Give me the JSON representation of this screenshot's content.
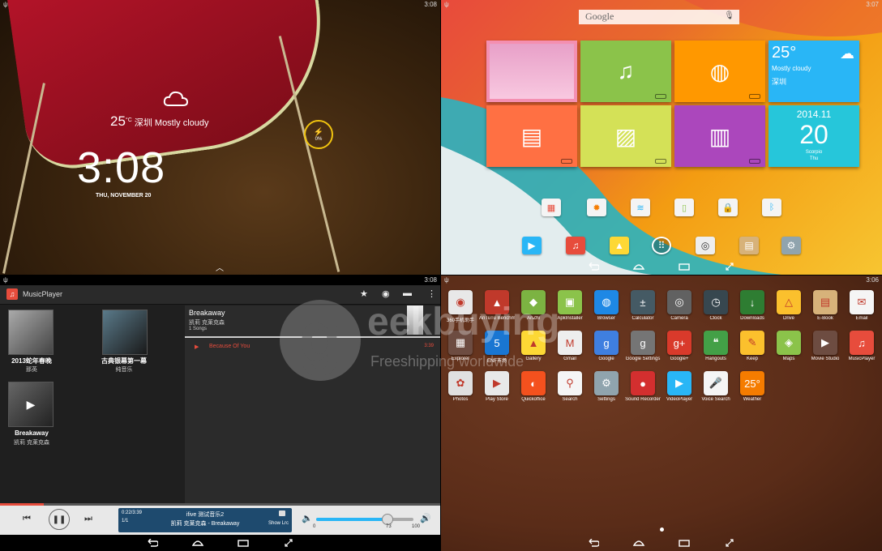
{
  "lockscreen": {
    "time_status": "3:08",
    "temperature": "25",
    "temp_unit": "°C",
    "weather_text": "深圳 Mostly cloudy",
    "clock": "3:08",
    "date": "THU, NOVEMBER 20",
    "battery": "0%"
  },
  "launcher": {
    "time_status": "3:07",
    "search_label": "Google",
    "weather_temp": "25°",
    "weather_desc": "Mostly cloudy",
    "weather_city": "深圳",
    "cal_month": "2014.11",
    "cal_day": "20",
    "cal_sub1": "Scorpio",
    "cal_sub2": "Thu"
  },
  "music": {
    "time_status": "3:08",
    "app_title": "MusicPlayer",
    "albums": [
      {
        "title": "2013蛇年春晚",
        "artist": "那英"
      },
      {
        "title": "古典银幕第一幕",
        "artist": "纯音乐"
      },
      {
        "title": "Breakaway",
        "artist": "凯莉 克莱克森"
      }
    ],
    "detail_title": "Breakaway",
    "detail_artist": "凯莉 克莱克森",
    "detail_count": "1 Songs",
    "track_name": "Because Of You",
    "track_time": "3:39",
    "now_time": "0:22/3:39",
    "now_index": "1/1",
    "now_title": "ifive 测试音乐2",
    "now_sub": "凯莉 克莱克森 - Breakaway",
    "show_lrc": "Show Lrc",
    "vol_min": "0",
    "vol_val": "73",
    "vol_max": "100",
    "progress": 0.1,
    "volume": 0.73
  },
  "drawer": {
    "time_status": "3:06",
    "apps": [
      {
        "label": "360手机助手",
        "color": "#e8e8e8",
        "glyph": "◉"
      },
      {
        "label": "AnTuTu Benchmark",
        "color": "#c0392b",
        "glyph": "▲"
      },
      {
        "label": "AnZhi",
        "color": "#7cb342",
        "glyph": "◆"
      },
      {
        "label": "ApkInstaller",
        "color": "#8bc34a",
        "glyph": "▣"
      },
      {
        "label": "Browser",
        "color": "#1e88e5",
        "glyph": "◍"
      },
      {
        "label": "Calculator",
        "color": "#455a64",
        "glyph": "±"
      },
      {
        "label": "Camera",
        "color": "#616161",
        "glyph": "◎"
      },
      {
        "label": "Clock",
        "color": "#37474f",
        "glyph": "◷"
      },
      {
        "label": "Downloads",
        "color": "#2e7d32",
        "glyph": "↓"
      },
      {
        "label": "Drive",
        "color": "#fbc02d",
        "glyph": "△"
      },
      {
        "label": "E-Book",
        "color": "#d7b27a",
        "glyph": "▤"
      },
      {
        "label": "Email",
        "color": "#f5f5f5",
        "glyph": "✉"
      },
      {
        "label": "Explorer",
        "color": "#6d4c41",
        "glyph": "▦"
      },
      {
        "label": "ENF市场",
        "color": "#1976d2",
        "glyph": "5"
      },
      {
        "label": "Gallery",
        "color": "#fdd835",
        "glyph": "▲"
      },
      {
        "label": "Gmail",
        "color": "#eeeeee",
        "glyph": "M"
      },
      {
        "label": "Google",
        "color": "#3f7fe0",
        "glyph": "g"
      },
      {
        "label": "Google Settings",
        "color": "#757575",
        "glyph": "g"
      },
      {
        "label": "Google+",
        "color": "#d93a2b",
        "glyph": "g+"
      },
      {
        "label": "Hangouts",
        "color": "#43a047",
        "glyph": "❝"
      },
      {
        "label": "Keep",
        "color": "#fbc02d",
        "glyph": "✎"
      },
      {
        "label": "Maps",
        "color": "#8bc34a",
        "glyph": "◈"
      },
      {
        "label": "Movie Studio",
        "color": "#6d4c41",
        "glyph": "▶"
      },
      {
        "label": "MusicPlayer",
        "color": "#e74c3c",
        "glyph": "♫"
      },
      {
        "label": "Photos",
        "color": "#e0e0e0",
        "glyph": "✿"
      },
      {
        "label": "Play Store",
        "color": "#e8e8e8",
        "glyph": "▶"
      },
      {
        "label": "Quickoffice",
        "color": "#f4511e",
        "glyph": "◐"
      },
      {
        "label": "Search",
        "color": "#f5f5f5",
        "glyph": "⚲"
      },
      {
        "label": "Settings",
        "color": "#90a4ae",
        "glyph": "⚙"
      },
      {
        "label": "Sound Recorder",
        "color": "#d32f2f",
        "glyph": "●"
      },
      {
        "label": "VideoPlayer",
        "color": "#29b6f6",
        "glyph": "▶"
      },
      {
        "label": "Voice Search",
        "color": "#f5f5f5",
        "glyph": "🎤"
      },
      {
        "label": "Weather",
        "color": "#f57c00",
        "glyph": "25°"
      }
    ]
  },
  "watermark": {
    "letter": "g",
    "brand": "eekbuying",
    "tagline": "Freeshipping worldwide"
  }
}
